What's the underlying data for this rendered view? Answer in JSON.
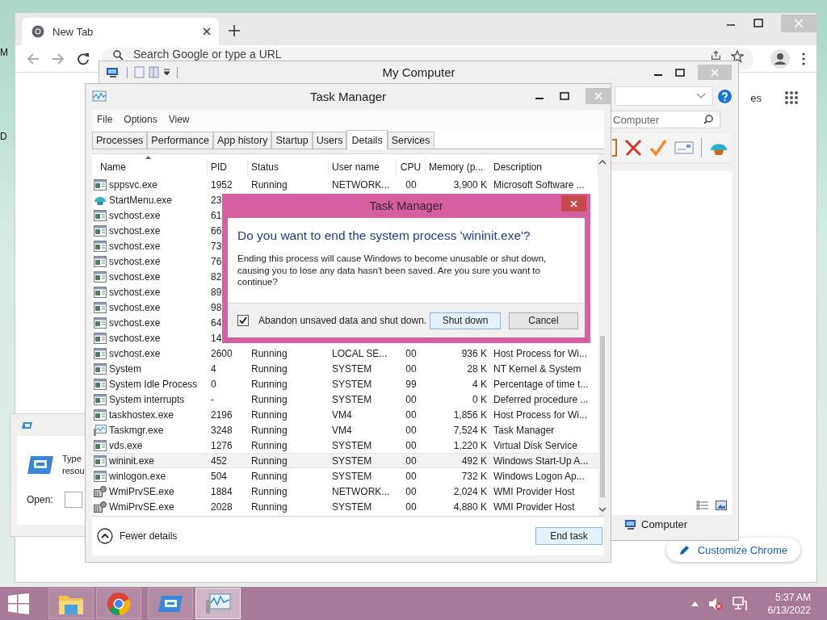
{
  "desktop": {
    "labels": [
      "M",
      "D"
    ]
  },
  "chrome": {
    "tabs": [
      {
        "label": "New Tab",
        "selected": true
      }
    ],
    "omnibox": {
      "placeholder": "Search Google or type a URL"
    },
    "top_link": "es",
    "customize_button": "Customize Chrome"
  },
  "my_computer": {
    "title": "My Computer",
    "search": {
      "placeholder": "Computer"
    },
    "status_bar": "Computer"
  },
  "run_dialog": {
    "description_lines": [
      "Type",
      "resou"
    ],
    "open_label": "Open:"
  },
  "task_manager": {
    "title": "Task Manager",
    "menu": [
      "File",
      "Options",
      "View"
    ],
    "tabs": [
      {
        "label": "Processes",
        "selected": false
      },
      {
        "label": "Performance",
        "selected": false
      },
      {
        "label": "App history",
        "selected": false
      },
      {
        "label": "Startup",
        "selected": false
      },
      {
        "label": "Users",
        "selected": false
      },
      {
        "label": "Details",
        "selected": true
      },
      {
        "label": "Services",
        "selected": false
      }
    ],
    "columns": [
      "Name",
      "PID",
      "Status",
      "User name",
      "CPU",
      "Memory (p...",
      "Description"
    ],
    "rows": [
      {
        "kind": "window",
        "name": "sppsvc.exe",
        "pid": "1952",
        "status": "Running",
        "user": "NETWORK...",
        "cpu": "00",
        "memory": "3,900 K",
        "description": "Microsoft Software ...",
        "selected": false
      },
      {
        "kind": "shell",
        "name": "StartMenu.exe",
        "pid": "23",
        "selected": false
      },
      {
        "kind": "window",
        "name": "svchost.exe",
        "pid": "61",
        "selected": false
      },
      {
        "kind": "window",
        "name": "svchost.exe",
        "pid": "66",
        "selected": false
      },
      {
        "kind": "window",
        "name": "svchost.exe",
        "pid": "73",
        "selected": false
      },
      {
        "kind": "window",
        "name": "svchost.exe",
        "pid": "76",
        "selected": false
      },
      {
        "kind": "window",
        "name": "svchost.exe",
        "pid": "82",
        "selected": false
      },
      {
        "kind": "window",
        "name": "svchost.exe",
        "pid": "89",
        "selected": false
      },
      {
        "kind": "window",
        "name": "svchost.exe",
        "pid": "98",
        "selected": false
      },
      {
        "kind": "window",
        "name": "svchost.exe",
        "pid": "64",
        "selected": false
      },
      {
        "kind": "window",
        "name": "svchost.exe",
        "pid": "14",
        "selected": false
      },
      {
        "kind": "window",
        "name": "svchost.exe",
        "pid": "2600",
        "status": "Running",
        "user": "LOCAL SE...",
        "cpu": "00",
        "memory": "936 K",
        "description": "Host Process for Wi...",
        "selected": false
      },
      {
        "kind": "window",
        "name": "System",
        "pid": "4",
        "status": "Running",
        "user": "SYSTEM",
        "cpu": "00",
        "memory": "28 K",
        "description": "NT Kernel & System",
        "selected": false
      },
      {
        "kind": "window",
        "name": "System Idle Process",
        "pid": "0",
        "status": "Running",
        "user": "SYSTEM",
        "cpu": "99",
        "memory": "4 K",
        "description": "Percentage of time t...",
        "selected": false
      },
      {
        "kind": "window",
        "name": "System interrupts",
        "pid": "-",
        "status": "Running",
        "user": "SYSTEM",
        "cpu": "00",
        "memory": "0 K",
        "description": "Deferred procedure ...",
        "selected": false
      },
      {
        "kind": "window",
        "name": "taskhostex.exe",
        "pid": "2196",
        "status": "Running",
        "user": "VM4",
        "cpu": "00",
        "memory": "1,856 K",
        "description": "Host Process for Wi...",
        "selected": false
      },
      {
        "kind": "taskmgr",
        "name": "Taskmgr.exe",
        "pid": "3248",
        "status": "Running",
        "user": "VM4",
        "cpu": "00",
        "memory": "7,524 K",
        "description": "Task Manager",
        "selected": false
      },
      {
        "kind": "window",
        "name": "vds.exe",
        "pid": "1276",
        "status": "Running",
        "user": "SYSTEM",
        "cpu": "00",
        "memory": "1,220 K",
        "description": "Virtual Disk Service",
        "selected": false
      },
      {
        "kind": "window",
        "name": "wininit.exe",
        "pid": "452",
        "status": "Running",
        "user": "SYSTEM",
        "cpu": "00",
        "memory": "492 K",
        "description": "Windows Start-Up A...",
        "selected": true
      },
      {
        "kind": "window",
        "name": "winlogon.exe",
        "pid": "504",
        "status": "Running",
        "user": "SYSTEM",
        "cpu": "00",
        "memory": "732 K",
        "description": "Windows Logon Ap...",
        "selected": false
      },
      {
        "kind": "wmi",
        "name": "WmiPrvSE.exe",
        "pid": "1884",
        "status": "Running",
        "user": "NETWORK...",
        "cpu": "00",
        "memory": "2,024 K",
        "description": "WMI Provider Host",
        "selected": false
      },
      {
        "kind": "wmi",
        "name": "WmiPrvSE.exe",
        "pid": "2028",
        "status": "Running",
        "user": "SYSTEM",
        "cpu": "00",
        "memory": "4,880 K",
        "description": "WMI Provider Host",
        "selected": false
      }
    ],
    "fewer_details": "Fewer details",
    "end_task": "End task"
  },
  "dialog": {
    "title": "Task Manager",
    "heading": "Do you want to end the system process 'wininit.exe'?",
    "body": "Ending this process will cause Windows to become unusable or shut down, causing you to lose any data hasn't been saved. Are you sure you want to continue?",
    "checkbox": {
      "label": "Abandon unsaved data and shut down.",
      "checked": true
    },
    "buttons": [
      {
        "label": "Shut down",
        "kind": "default"
      },
      {
        "label": "Cancel",
        "kind": "normal"
      }
    ]
  },
  "taskbar": {
    "apps": [
      {
        "kind": "explorer",
        "active": false
      },
      {
        "kind": "chrome",
        "active": false
      },
      {
        "kind": "run",
        "active": false
      },
      {
        "kind": "taskmgr",
        "active": true
      }
    ],
    "time": "5:37 AM",
    "date": "6/13/2022"
  }
}
